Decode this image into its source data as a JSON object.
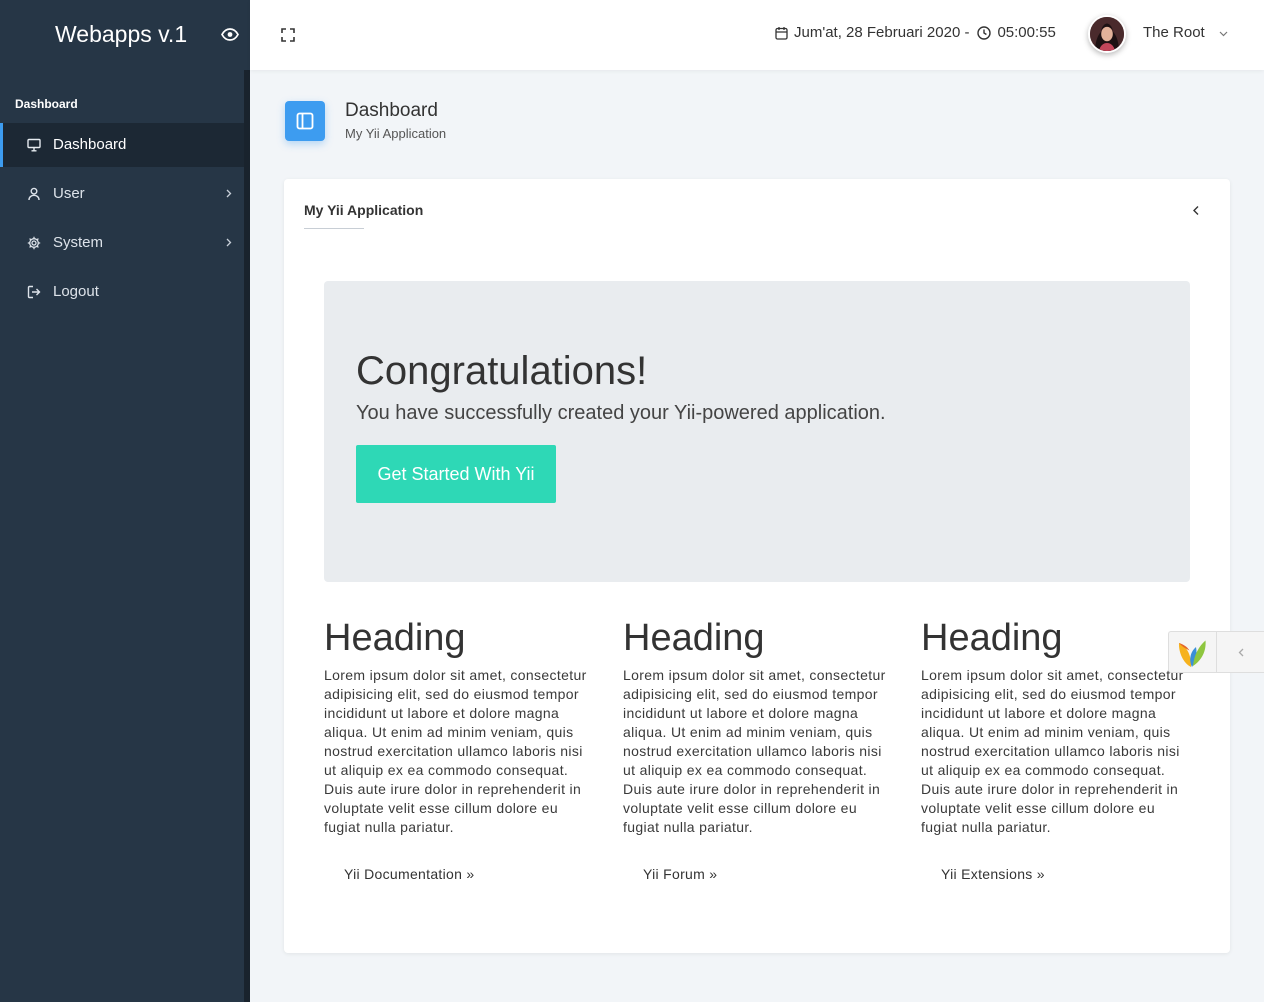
{
  "app": {
    "title": "Webapps v.1"
  },
  "colors": {
    "sidebar_bg": "#263646",
    "sidebar_active_bg": "#1c2834",
    "accent": "#3d9cf0",
    "primary_button": "#2ed8b6",
    "jumbotron_bg": "#e9ecef",
    "page_bg": "#f2f5f8"
  },
  "topbar": {
    "fullscreen_icon": "fullscreen-icon",
    "calendar_icon": "calendar-icon",
    "date": "Jum'at, 28 Februari 2020 -",
    "clock_icon": "clock-icon",
    "time": "05:00:55",
    "user_name": "The Root",
    "user_menu_icon": "chevron-down-icon"
  },
  "sidebar": {
    "toggle_icon": "eye-icon",
    "section_label": "Dashboard",
    "items": [
      {
        "label": "Dashboard",
        "icon": "monitor-icon",
        "active": true,
        "has_submenu": false
      },
      {
        "label": "User",
        "icon": "user-icon",
        "active": false,
        "has_submenu": true
      },
      {
        "label": "System",
        "icon": "gear-icon",
        "active": false,
        "has_submenu": true
      },
      {
        "label": "Logout",
        "icon": "logout-icon",
        "active": false,
        "has_submenu": false
      }
    ]
  },
  "page_header": {
    "icon": "layout-icon",
    "title": "Dashboard",
    "subtitle": "My Yii Application"
  },
  "card": {
    "title": "My Yii Application",
    "collapse_icon": "chevron-left-icon"
  },
  "jumbotron": {
    "heading": "Congratulations!",
    "lead": "You have successfully created your Yii-powered application.",
    "button_label": "Get Started With Yii"
  },
  "columns": [
    {
      "heading": "Heading",
      "body": "Lorem ipsum dolor sit amet, consectetur adipisicing elit, sed do eiusmod tempor incididunt ut labore et dolore magna aliqua. Ut enim ad minim veniam, quis nostrud exercitation ullamco laboris nisi ut aliquip ex ea commodo consequat. Duis aute irure dolor in reprehenderit in voluptate velit esse cillum dolore eu fugiat nulla pariatur.",
      "link": "Yii Documentation »"
    },
    {
      "heading": "Heading",
      "body": "Lorem ipsum dolor sit amet, consectetur adipisicing elit, sed do eiusmod tempor incididunt ut labore et dolore magna aliqua. Ut enim ad minim veniam, quis nostrud exercitation ullamco laboris nisi ut aliquip ex ea commodo consequat. Duis aute irure dolor in reprehenderit in voluptate velit esse cillum dolore eu fugiat nulla pariatur.",
      "link": "Yii Forum »"
    },
    {
      "heading": "Heading",
      "body": "Lorem ipsum dolor sit amet, consectetur adipisicing elit, sed do eiusmod tempor incididunt ut labore et dolore magna aliqua. Ut enim ad minim veniam, quis nostrud exercitation ullamco laboris nisi ut aliquip ex ea commodo consequat. Duis aute irure dolor in reprehenderit in voluptate velit esse cillum dolore eu fugiat nulla pariatur.",
      "link": "Yii Extensions »"
    }
  ],
  "debug_toolbar": {
    "logo": "yii-logo-icon",
    "toggle_icon": "chevron-left-icon"
  }
}
